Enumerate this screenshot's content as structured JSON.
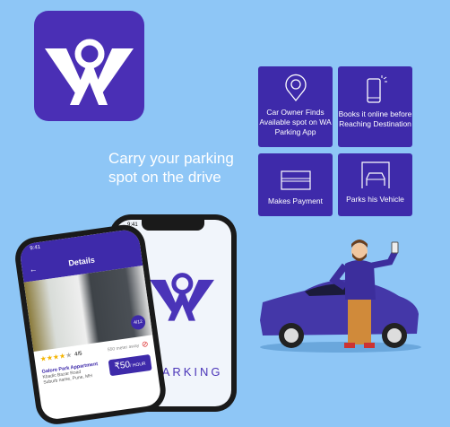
{
  "colors": {
    "background": "#8ec6f6",
    "brand": "#4a2fb5",
    "card": "#3e2aaa"
  },
  "tagline": "Carry your parking spot on the drive",
  "steps": [
    {
      "icon": "map-pin-icon",
      "label": "Car Owner Finds Available spot on WA Parking App"
    },
    {
      "icon": "smartphone-icon",
      "label": "Books it online before Reaching Destination"
    },
    {
      "icon": "credit-card-icon",
      "label": "Makes Payment"
    },
    {
      "icon": "car-garage-icon",
      "label": "Parks his Vehicle"
    }
  ],
  "splash_phone": {
    "time": "9:41",
    "brand_text": "PARKING"
  },
  "details_phone": {
    "time": "9:41",
    "title": "Details",
    "photo_counter": "4/12",
    "rating": "4/5",
    "rating_stars": 4,
    "distance": "550 meter away",
    "listing_name": "Galore Park Appartment",
    "address_line1": "Kbadic Bazar Road",
    "address_line2": "Suburb name, Pune, MH",
    "price": "₹50",
    "price_unit": "/ HOUR"
  }
}
